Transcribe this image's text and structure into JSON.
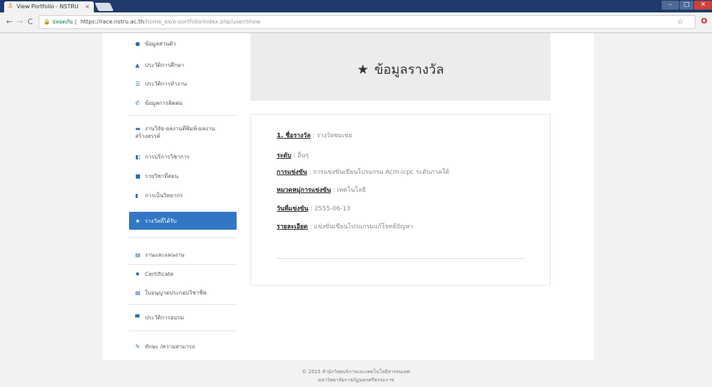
{
  "browser": {
    "tab_title": "View Portfolio - NSTRU",
    "tab_close": "×",
    "secure_label": "ปลอดภัย",
    "url_host": "https://race.nstru.ac.th",
    "url_path": "/home_ex/e-portfolio/index.php/user/show"
  },
  "sidebar": {
    "items": [
      {
        "icon": "user-icon",
        "glyph": "●",
        "label": "ข้อมูลส่วนตัว"
      },
      {
        "icon": "graduation-cap-icon",
        "glyph": "▲",
        "label": "ประวัติการศึกษา"
      },
      {
        "icon": "list-icon",
        "glyph": "☰",
        "label": "ประวัติการทำงาน"
      },
      {
        "icon": "phone-icon",
        "glyph": "✆",
        "label": "ข้อมูลการติดต่อ"
      },
      {
        "icon": "folder-icon",
        "glyph": "▬",
        "label": "งานวิจัย-ผลงานตีพิมพ์-ผลงานสร้างสรรค์"
      },
      {
        "icon": "presentation-icon",
        "glyph": "◧",
        "label": "การบริการวิชาการ"
      },
      {
        "icon": "book-icon",
        "glyph": "■",
        "label": "รายวิชาที่สอน"
      },
      {
        "icon": "bookmark-icon",
        "glyph": "▮",
        "label": "การเป็นวิทยากร"
      },
      {
        "icon": "star-icon",
        "glyph": "★",
        "label": "รางวัลที่ได้รับ"
      },
      {
        "icon": "calendar-icon",
        "glyph": "▤",
        "label": "งานและแผนงาน"
      },
      {
        "icon": "certificate-icon",
        "glyph": "✹",
        "label": "Certificate"
      },
      {
        "icon": "id-card-icon",
        "glyph": "▤",
        "label": "ใบอนุญาตประกอบวิชาชีพ"
      },
      {
        "icon": "training-icon",
        "glyph": "▀",
        "label": "ประวัติการอบรม"
      },
      {
        "icon": "pencil-icon",
        "glyph": "✎",
        "label": "ทักษะ /ความสามารถ"
      }
    ]
  },
  "main": {
    "title": "ข้อมูลรางวัล",
    "title_icon": "star-icon",
    "award": {
      "name_label": "1. ชื่อรางวัล",
      "name_value": "รางวัลชมเชย",
      "level_label": "ระดับ",
      "level_value": "อื่นๆ",
      "competition_label": "การแข่งขัน",
      "competition_value": "การแข่งขันเขียนโปรแกรม Acm-icpc ระดับภาคใต้",
      "category_label": "หมวดหมู่การแข่งขัน",
      "category_value": "เทคโนโลยี",
      "date_label": "วันที่แข่งขัน",
      "date_value": "2555-06-13",
      "detail_label": "รายละเอียด",
      "detail_value": "แข่งขันเขียนโปรแกรมแก้โจทย์ปัญหา"
    }
  },
  "footer": {
    "line1": "© 2015 สำนักวิทยบริการและเทคโนโลยีสารสนเทศ",
    "line2": "มหาวิทยาลัยราชภัฏนครศรีธรรมราช"
  },
  "colors": {
    "active_item": "#3377c4",
    "title_bar": "#1f3a6b"
  }
}
